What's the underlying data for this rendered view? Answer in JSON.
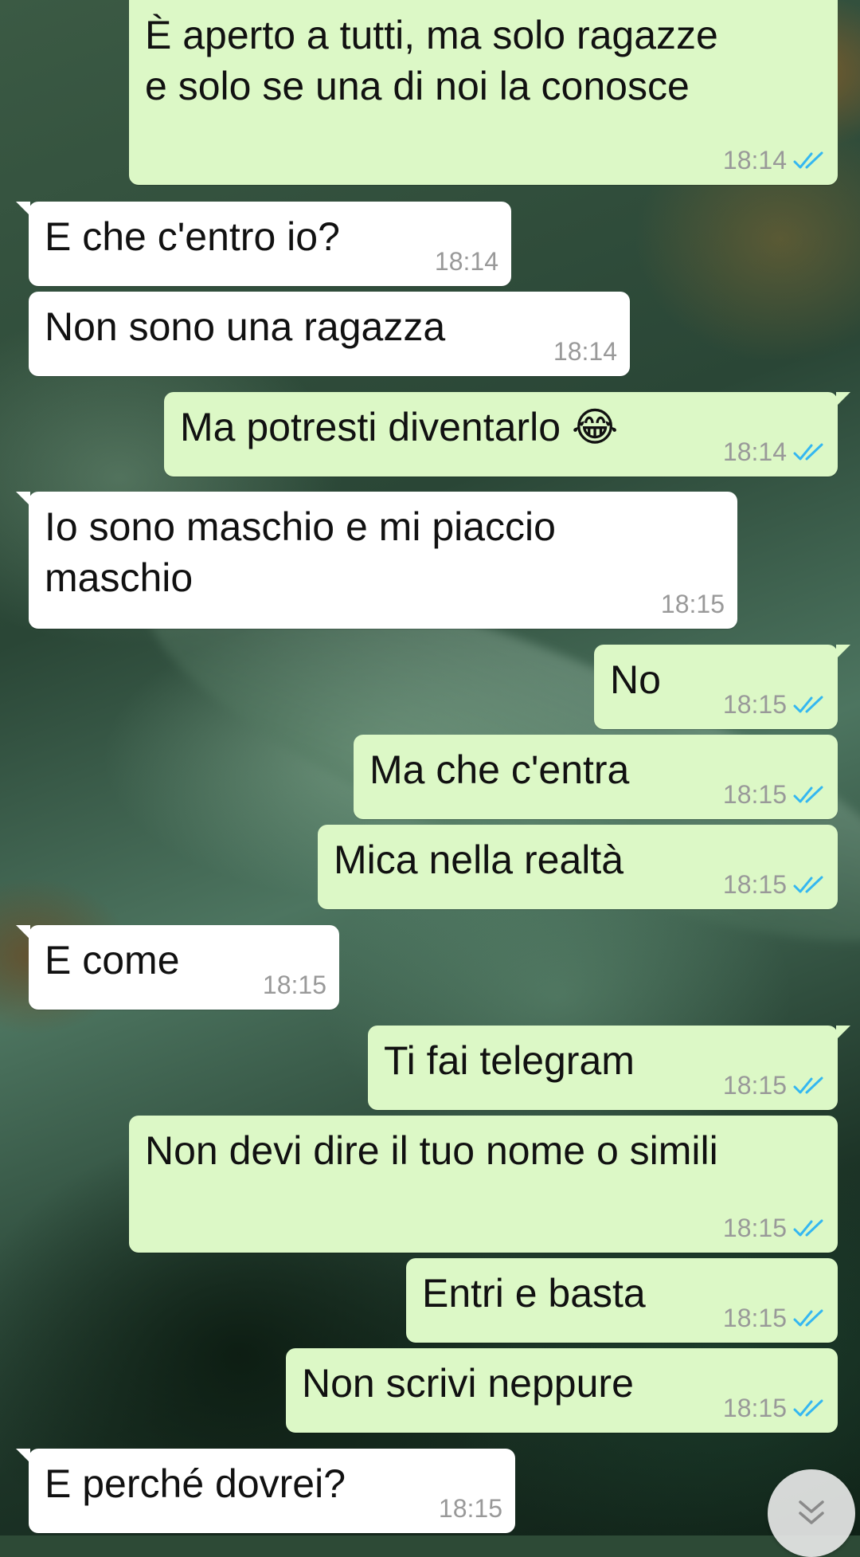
{
  "conversation": {
    "messages": [
      {
        "dir": "out",
        "text": "È aperto a tutti, ma solo ragazze\ne solo se una di noi la conosce",
        "time": "18:14",
        "read": true
      },
      {
        "dir": "in",
        "text": "E che c'entro io?",
        "time": "18:14"
      },
      {
        "dir": "in",
        "text": "Non sono una ragazza",
        "time": "18:14"
      },
      {
        "dir": "out",
        "text": "Ma potresti diventarlo 😂",
        "time": "18:14",
        "read": true
      },
      {
        "dir": "in",
        "text": "Io sono maschio e mi piaccio\nmaschio",
        "time": "18:15"
      },
      {
        "dir": "out",
        "text": "No",
        "time": "18:15",
        "read": true
      },
      {
        "dir": "out",
        "text": "Ma che c'entra",
        "time": "18:15",
        "read": true
      },
      {
        "dir": "out",
        "text": "Mica nella realtà",
        "time": "18:15",
        "read": true
      },
      {
        "dir": "in",
        "text": "E come",
        "time": "18:15"
      },
      {
        "dir": "out",
        "text": "Ti fai telegram",
        "time": "18:15",
        "read": true
      },
      {
        "dir": "out",
        "text": "Non devi dire il tuo nome o simili",
        "time": "18:15",
        "read": true
      },
      {
        "dir": "out",
        "text": "Entri e basta",
        "time": "18:15",
        "read": true
      },
      {
        "dir": "out",
        "text": "Non scrivi neppure",
        "time": "18:15",
        "read": true
      },
      {
        "dir": "in",
        "text": "E perché dovrei?",
        "time": "18:15"
      }
    ]
  },
  "colors": {
    "outgoing_bubble": "#dcf8c6",
    "incoming_bubble": "#ffffff",
    "read_ticks": "#34b7f1",
    "timestamp": "#999999"
  },
  "icons": {
    "read_receipt": "double-check-icon",
    "scroll_down": "double-chevron-down-icon"
  }
}
